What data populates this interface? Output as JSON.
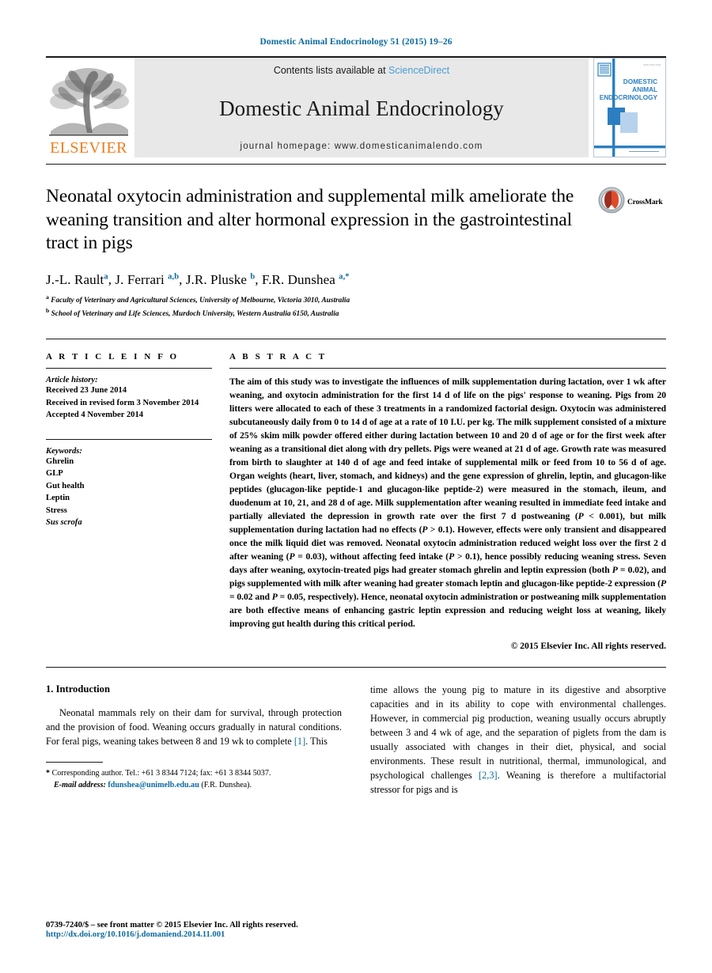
{
  "running_head": "Domestic Animal Endocrinology 51 (2015) 19–26",
  "masthead": {
    "publisher_logo_label": "ELSEVIER",
    "publisher_logo_icon": "elsevier-tree-icon",
    "contents_prefix": "Contents lists available at ",
    "contents_link": "ScienceDirect",
    "journal_name": "Domestic Animal Endocrinology",
    "homepage": "journal homepage: www.domesticanimalendo.com",
    "cover_title_lines": [
      "DOMESTIC",
      "ANIMAL",
      "ENDOCRINOLOGY"
    ],
    "cover_icon": "journal-cover-thumbnail",
    "accent_link_color": "#4a9dd4",
    "elsevier_orange": "#f07c1a",
    "journal_blue": "#2b7fc1"
  },
  "title": "Neonatal oxytocin administration and supplemental milk ameliorate the weaning transition and alter hormonal expression in the gastrointestinal tract in pigs",
  "authors_html": "J.-L. Rault<sup>a</sup>, J. Ferrari <sup>a,b</sup>, J.R. Pluske <sup>b</sup>, F.R. Dunshea <sup>a,*</sup>",
  "affiliations": [
    "Faculty of Veterinary and Agricultural Sciences, University of Melbourne, Victoria 3010, Australia",
    "School of Veterinary and Life Sciences, Murdoch University, Western Australia 6150, Australia"
  ],
  "affiliation_markers": [
    "a",
    "b"
  ],
  "crossmark": {
    "label": "CrossMark",
    "icon": "crossmark-icon"
  },
  "article_info": {
    "heading": "A R T I C L E  I N F O",
    "history_label": "Article history:",
    "history": [
      "Received 23 June 2014",
      "Received in revised form 3 November 2014",
      "Accepted 4 November 2014"
    ],
    "keywords_label": "Keywords:",
    "keywords": [
      "Ghrelin",
      "GLP",
      "Gut health",
      "Leptin",
      "Stress",
      "Sus scrofa"
    ],
    "keywords_italic_flags": [
      false,
      false,
      false,
      false,
      false,
      true
    ]
  },
  "abstract": {
    "heading": "A B S T R A C T",
    "text": "The aim of this study was to investigate the influences of milk supplementation during lactation, over 1 wk after weaning, and oxytocin administration for the first 14 d of life on the pigs' response to weaning. Pigs from 20 litters were allocated to each of these 3 treatments in a randomized factorial design. Oxytocin was administered subcutaneously daily from 0 to 14 d of age at a rate of 10 I.U. per kg. The milk supplement consisted of a mixture of 25% skim milk powder offered either during lactation between 10 and 20 d of age or for the first week after weaning as a transitional diet along with dry pellets. Pigs were weaned at 21 d of age. Growth rate was measured from birth to slaughter at 140 d of age and feed intake of supplemental milk or feed from 10 to 56 d of age. Organ weights (heart, liver, stomach, and kidneys) and the gene expression of ghrelin, leptin, and glucagon-like peptides (glucagon-like peptide-1 and glucagon-like peptide-2) were measured in the stomach, ileum, and duodenum at 10, 21, and 28 d of age. Milk supplementation after weaning resulted in immediate feed intake and partially alleviated the depression in growth rate over the first 7 d postweaning (P < 0.001), but milk supplementation during lactation had no effects (P > 0.1). However, effects were only transient and disappeared once the milk liquid diet was removed. Neonatal oxytocin administration reduced weight loss over the first 2 d after weaning (P = 0.03), without affecting feed intake (P > 0.1), hence possibly reducing weaning stress. Seven days after weaning, oxytocin-treated pigs had greater stomach ghrelin and leptin expression (both P = 0.02), and pigs supplemented with milk after weaning had greater stomach leptin and glucagon-like peptide-2 expression (P = 0.02 and P = 0.05, respectively). Hence, neonatal oxytocin administration or postweaning milk supplementation are both effective means of enhancing gastric leptin expression and reducing weight loss at weaning, likely improving gut health during this critical period.",
    "copyright": "© 2015 Elsevier Inc. All rights reserved."
  },
  "body": {
    "section_number_title": "1. Introduction",
    "left_paragraph": "Neonatal mammals rely on their dam for survival, through protection and the provision of food. Weaning occurs gradually in natural conditions. For feral pigs, weaning takes between 8 and 19 wk to complete [1]. This",
    "left_ref": "[1]",
    "right_paragraph": "time allows the young pig to mature in its digestive and absorptive capacities and in its ability to cope with environmental challenges. However, in commercial pig production, weaning usually occurs abruptly between 3 and 4 wk of age, and the separation of piglets from the dam is usually associated with changes in their diet, physical, and social environments. These result in nutritional, thermal, immunological, and psychological challenges [2,3]. Weaning is therefore a multifactorial stressor for pigs and is",
    "right_ref": "[2,3]"
  },
  "footnote": {
    "star": "*",
    "corresponding": "Corresponding author. Tel.: +61 3 8344 7124; fax: +61 3 8344 5037.",
    "email_label": "E-mail address:",
    "email": "fdunshea@unimelb.edu.au",
    "email_owner": "(F.R. Dunshea)."
  },
  "bottom": {
    "issn_line": "0739-7240/$ – see front matter © 2015 Elsevier Inc. All rights reserved.",
    "doi": "http://dx.doi.org/10.1016/j.domaniend.2014.11.001"
  }
}
